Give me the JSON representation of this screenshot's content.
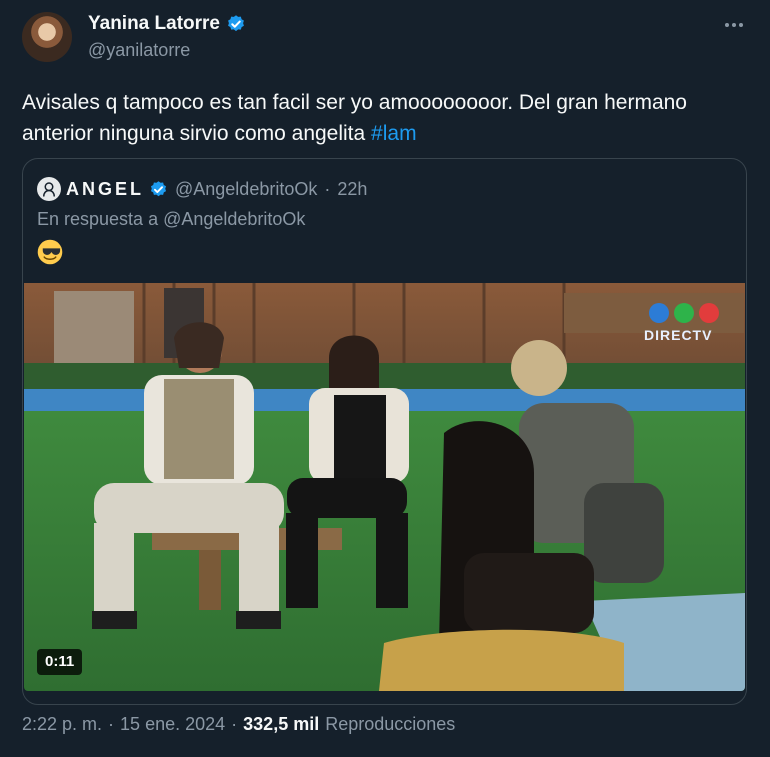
{
  "author": {
    "display_name": "Yanina Latorre",
    "handle": "@yanilatorre",
    "verified": true
  },
  "tweet": {
    "text": "Avisales q tampoco es tan facil ser yo amoooooooor. Del gran hermano anterior ninguna sirvio como angelita",
    "hashtag": "#lam"
  },
  "quoted": {
    "name": "ANGEL",
    "handle": "@AngeldebritoOk",
    "separator": "·",
    "time": "22h",
    "reply_to": "En respuesta a @AngeldebritoOk",
    "emoji": "smiling-face-with-sunglasses",
    "video_duration": "0:11",
    "watermark": "DIRECTV"
  },
  "footer": {
    "time": "2:22 p. m.",
    "dot": "·",
    "date": "15 ene. 2024",
    "views_count": "332,5 mil",
    "views_label": "Reproducciones"
  },
  "colors": {
    "background": "#15202b",
    "text": "#f7f9f9",
    "secondary": "#8b98a5",
    "accent": "#1d9bf0",
    "border": "#38444d"
  }
}
